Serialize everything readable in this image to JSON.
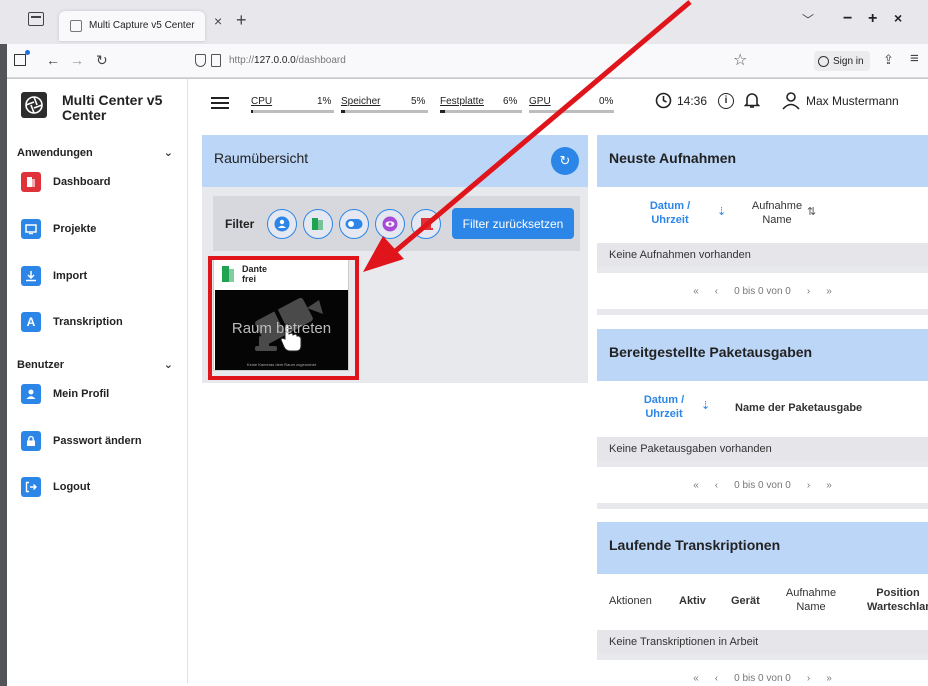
{
  "browser": {
    "tab_title": "Multi Capture v5 Center",
    "url_prefix": "http://",
    "url_host": "127.0.0.0",
    "url_path": "/dashboard",
    "sign_in": "Sign in"
  },
  "sidebar": {
    "brand": "Multi Center v5 Center",
    "section_apps": "Anwendungen",
    "section_user": "Benutzer",
    "items": [
      {
        "label": "Dashboard",
        "icon": "door-icon",
        "color": "#e0323b"
      },
      {
        "label": "Projekte",
        "icon": "monitor-icon",
        "color": "#2c86e8"
      },
      {
        "label": "Import",
        "icon": "download-icon",
        "color": "#2c86e8"
      },
      {
        "label": "Transkription",
        "icon": "letter-a-icon",
        "color": "#2c86e8"
      },
      {
        "label": "Mein Profil",
        "icon": "user-icon",
        "color": "#2c86e8"
      },
      {
        "label": "Passwort ändern",
        "icon": "lock-icon",
        "color": "#2c86e8"
      },
      {
        "label": "Logout",
        "icon": "logout-icon",
        "color": "#2c86e8"
      }
    ]
  },
  "header": {
    "stats": [
      {
        "label": "CPU",
        "value": "1%",
        "fraction": 0.01
      },
      {
        "label": "Speicher",
        "value": "5%",
        "fraction": 0.05
      },
      {
        "label": "Festplatte",
        "value": "6%",
        "fraction": 0.06
      },
      {
        "label": "GPU",
        "value": "0%",
        "fraction": 0.0
      }
    ],
    "time": "14:36",
    "user": "Max Mustermann"
  },
  "rooms": {
    "title": "Raumübersicht",
    "filter_label": "Filter",
    "reset_label": "Filter zurücksetzen",
    "card": {
      "name": "Dante",
      "status": "frei",
      "enter_label": "Raum betreten",
      "note": "Keine Kameras dem Raum zugeordnet"
    }
  },
  "recordings": {
    "title": "Neuste Aufnahmen",
    "col_date": "Datum / Uhrzeit",
    "col_name": "Aufnahme Name",
    "empty": "Keine Aufnahmen vorhanden",
    "pager": "0 bis 0 von 0"
  },
  "packages": {
    "title": "Bereitgestellte Paketausgaben",
    "col_date": "Datum / Uhrzeit",
    "col_name": "Name der Paketausgabe",
    "empty": "Keine Paketausgaben vorhanden",
    "pager": "0 bis 0 von 0"
  },
  "transcriptions": {
    "title": "Laufende Transkriptionen",
    "col_actions": "Aktionen",
    "col_active": "Aktiv",
    "col_device": "Gerät",
    "col_name": "Aufnahme Name",
    "col_position": "Position Warteschlange",
    "empty": "Keine Transkriptionen in Arbeit",
    "pager": "0 bis 0 von 0"
  },
  "colors": {
    "accent": "#2c86e8",
    "panel_head": "#bcd6f8",
    "highlight": "#e0141b"
  }
}
